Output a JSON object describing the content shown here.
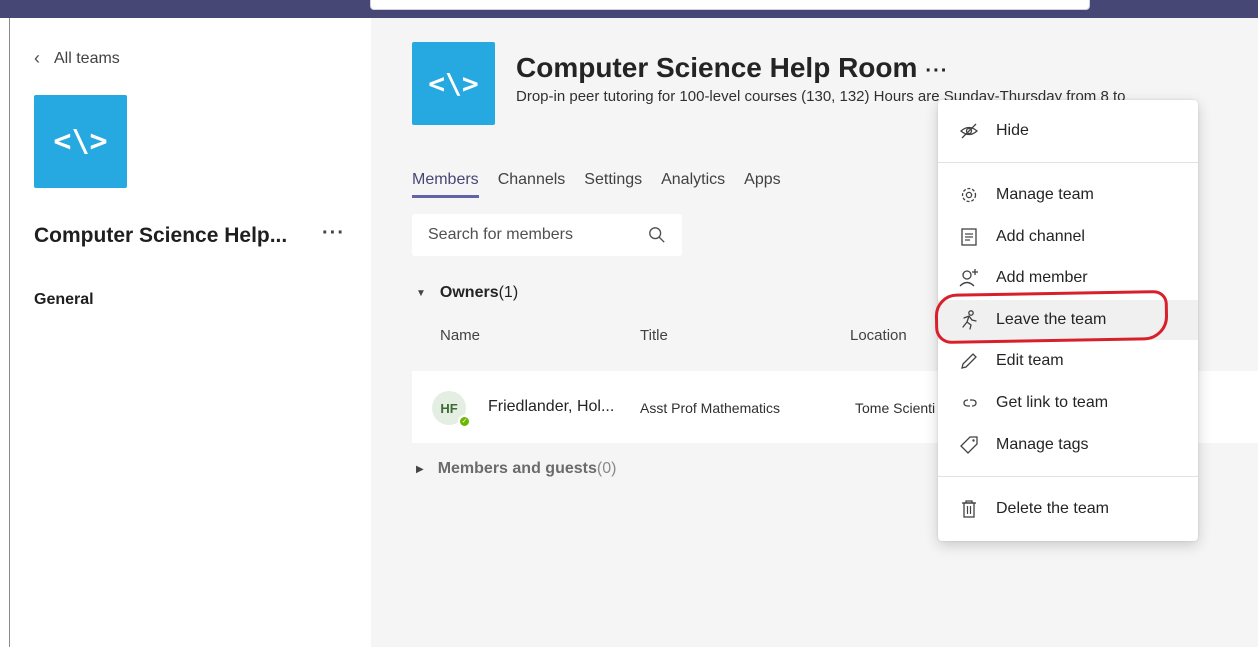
{
  "sidebar": {
    "back_label": "All teams",
    "team_logo_glyph": "<\\>",
    "team_name": "Computer Science Help...",
    "more_glyph": "···",
    "channels": [
      {
        "label": "General"
      }
    ]
  },
  "header": {
    "team_logo_glyph": "<\\>",
    "title": "Computer Science Help Room",
    "more_glyph": "···",
    "description": "Drop-in peer tutoring for 100-level courses (130, 132) Hours are Sunday-Thursday from 8 to"
  },
  "tabs": [
    {
      "label": "Members",
      "active": true
    },
    {
      "label": "Channels",
      "active": false
    },
    {
      "label": "Settings",
      "active": false
    },
    {
      "label": "Analytics",
      "active": false
    },
    {
      "label": "Apps",
      "active": false
    }
  ],
  "search": {
    "placeholder": "Search for members",
    "icon": "search-icon"
  },
  "owners": {
    "label": "Owners",
    "count": "(1)"
  },
  "columns": {
    "name": "Name",
    "title": "Title",
    "location": "Location"
  },
  "members": [
    {
      "initials": "HF",
      "name": "Friedlander, Hol...",
      "title": "Asst Prof Mathematics",
      "location": "Tome Scienti",
      "presence": "available"
    }
  ],
  "guests": {
    "label": "Members and guests",
    "count": "(0)"
  },
  "context_menu": {
    "items": [
      {
        "label": "Hide",
        "icon": "hide-eye-icon"
      },
      {
        "label": "Manage team",
        "icon": "gear-icon"
      },
      {
        "label": "Add channel",
        "icon": "channel-icon"
      },
      {
        "label": "Add member",
        "icon": "add-person-icon"
      },
      {
        "label": "Leave the team",
        "icon": "leave-icon",
        "highlighted": true
      },
      {
        "label": "Edit team",
        "icon": "pencil-icon"
      },
      {
        "label": "Get link to team",
        "icon": "link-icon"
      },
      {
        "label": "Manage tags",
        "icon": "tag-icon"
      },
      {
        "label": "Delete the team",
        "icon": "trash-icon"
      }
    ]
  },
  "colors": {
    "accent": "#6264a7",
    "topbar": "#464775",
    "team_logo": "#26a8e0",
    "annotation": "#d8202c",
    "presence": "#6bb700"
  }
}
